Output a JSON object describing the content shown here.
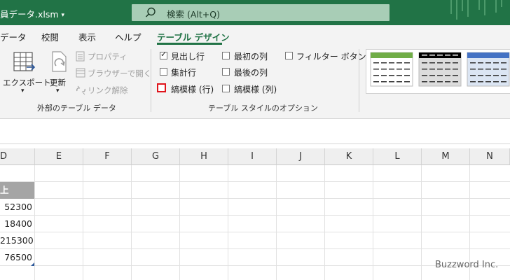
{
  "titlebar": {
    "file_name": "員データ.xlsm",
    "caret": "▾",
    "search_text": "検索 (Alt+Q)"
  },
  "tabs": [
    {
      "label": "データ"
    },
    {
      "label": "校閲"
    },
    {
      "label": "表示"
    },
    {
      "label": "ヘルプ"
    },
    {
      "label": "テーブル デザイン"
    }
  ],
  "ribbon": {
    "export_label": "エクスポート",
    "export_caret": "▾",
    "refresh_label": "更新",
    "refresh_caret": "▾",
    "properties_label": "プロパティ",
    "open_browser_label": "ブラウザーで開く",
    "unlink_label": "リンク解除",
    "group_external": "外部のテーブル データ",
    "group_style_options": "テーブル スタイルのオプション",
    "options": [
      {
        "label": "見出し行",
        "checked": true
      },
      {
        "label": "集計行",
        "checked": false
      },
      {
        "label": "縞模様 (行)",
        "checked": false,
        "highlighted": true
      },
      {
        "label": "最初の列",
        "checked": false
      },
      {
        "label": "最後の列",
        "checked": false
      },
      {
        "label": "縞模様 (列)",
        "checked": false
      },
      {
        "label": "フィルター ボタン",
        "checked": false
      }
    ],
    "style_swatch_colors": [
      "#70ad47",
      "#000000",
      "#4472c4"
    ]
  },
  "grid": {
    "columns": [
      "D",
      "E",
      "F",
      "G",
      "H",
      "I",
      "J",
      "K",
      "L",
      "M",
      "N"
    ],
    "header_cell": "上",
    "values": [
      "52300",
      "18400",
      "215300",
      "76500"
    ]
  },
  "watermark": "Buzzword Inc."
}
